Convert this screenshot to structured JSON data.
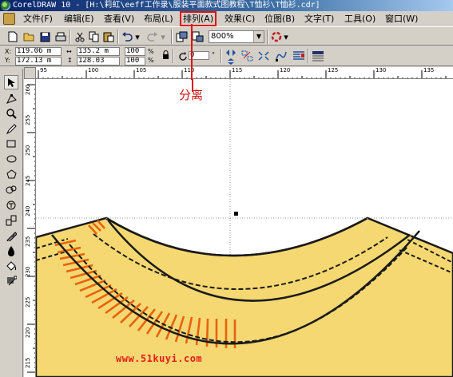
{
  "window": {
    "title": "CorelDRAW 10 - [H:\\莉虹\\eeff工作录\\服装平面款式图教程\\T恤衫\\T恤衫.cdr]"
  },
  "menu": [
    {
      "label": "文件(F)"
    },
    {
      "label": "编辑(E)"
    },
    {
      "label": "查看(V)"
    },
    {
      "label": "布局(L)"
    },
    {
      "label": "排列(A)"
    },
    {
      "label": "效果(C)"
    },
    {
      "label": "位图(B)"
    },
    {
      "label": "文字(T)"
    },
    {
      "label": "工具(O)"
    },
    {
      "label": "窗口(W)"
    }
  ],
  "toolbar": {
    "zoom_value": "800%"
  },
  "property_bar": {
    "x": "119.06 m",
    "y": "172.13 m",
    "width": "135.2 m",
    "height": "128.03",
    "scale_x": "100",
    "scale_y": "100",
    "pct": "%",
    "rotation": "0",
    "degree": "°"
  },
  "ruler": {
    "h_labels": [
      "95",
      "100",
      "105",
      "110",
      "115",
      "120",
      "125",
      "130",
      "135"
    ],
    "v_labels": [
      "260",
      "255",
      "250",
      "245",
      "240",
      "235",
      "230",
      "225",
      "220",
      "215"
    ]
  },
  "annotation": {
    "text": "分离"
  },
  "watermark": "www.51kuyi.com",
  "colors": {
    "shirt_fill": "#f5d871",
    "stripe": "#e8620e",
    "highlight": "#e01010",
    "outline": "#1a1a1a"
  },
  "icons": [
    "new-icon",
    "open-icon",
    "save-icon",
    "print-icon",
    "cut-icon",
    "copy-icon",
    "paste-icon",
    "undo-icon",
    "redo-icon",
    "import-icon",
    "export-icon",
    "app-launcher-icon"
  ]
}
